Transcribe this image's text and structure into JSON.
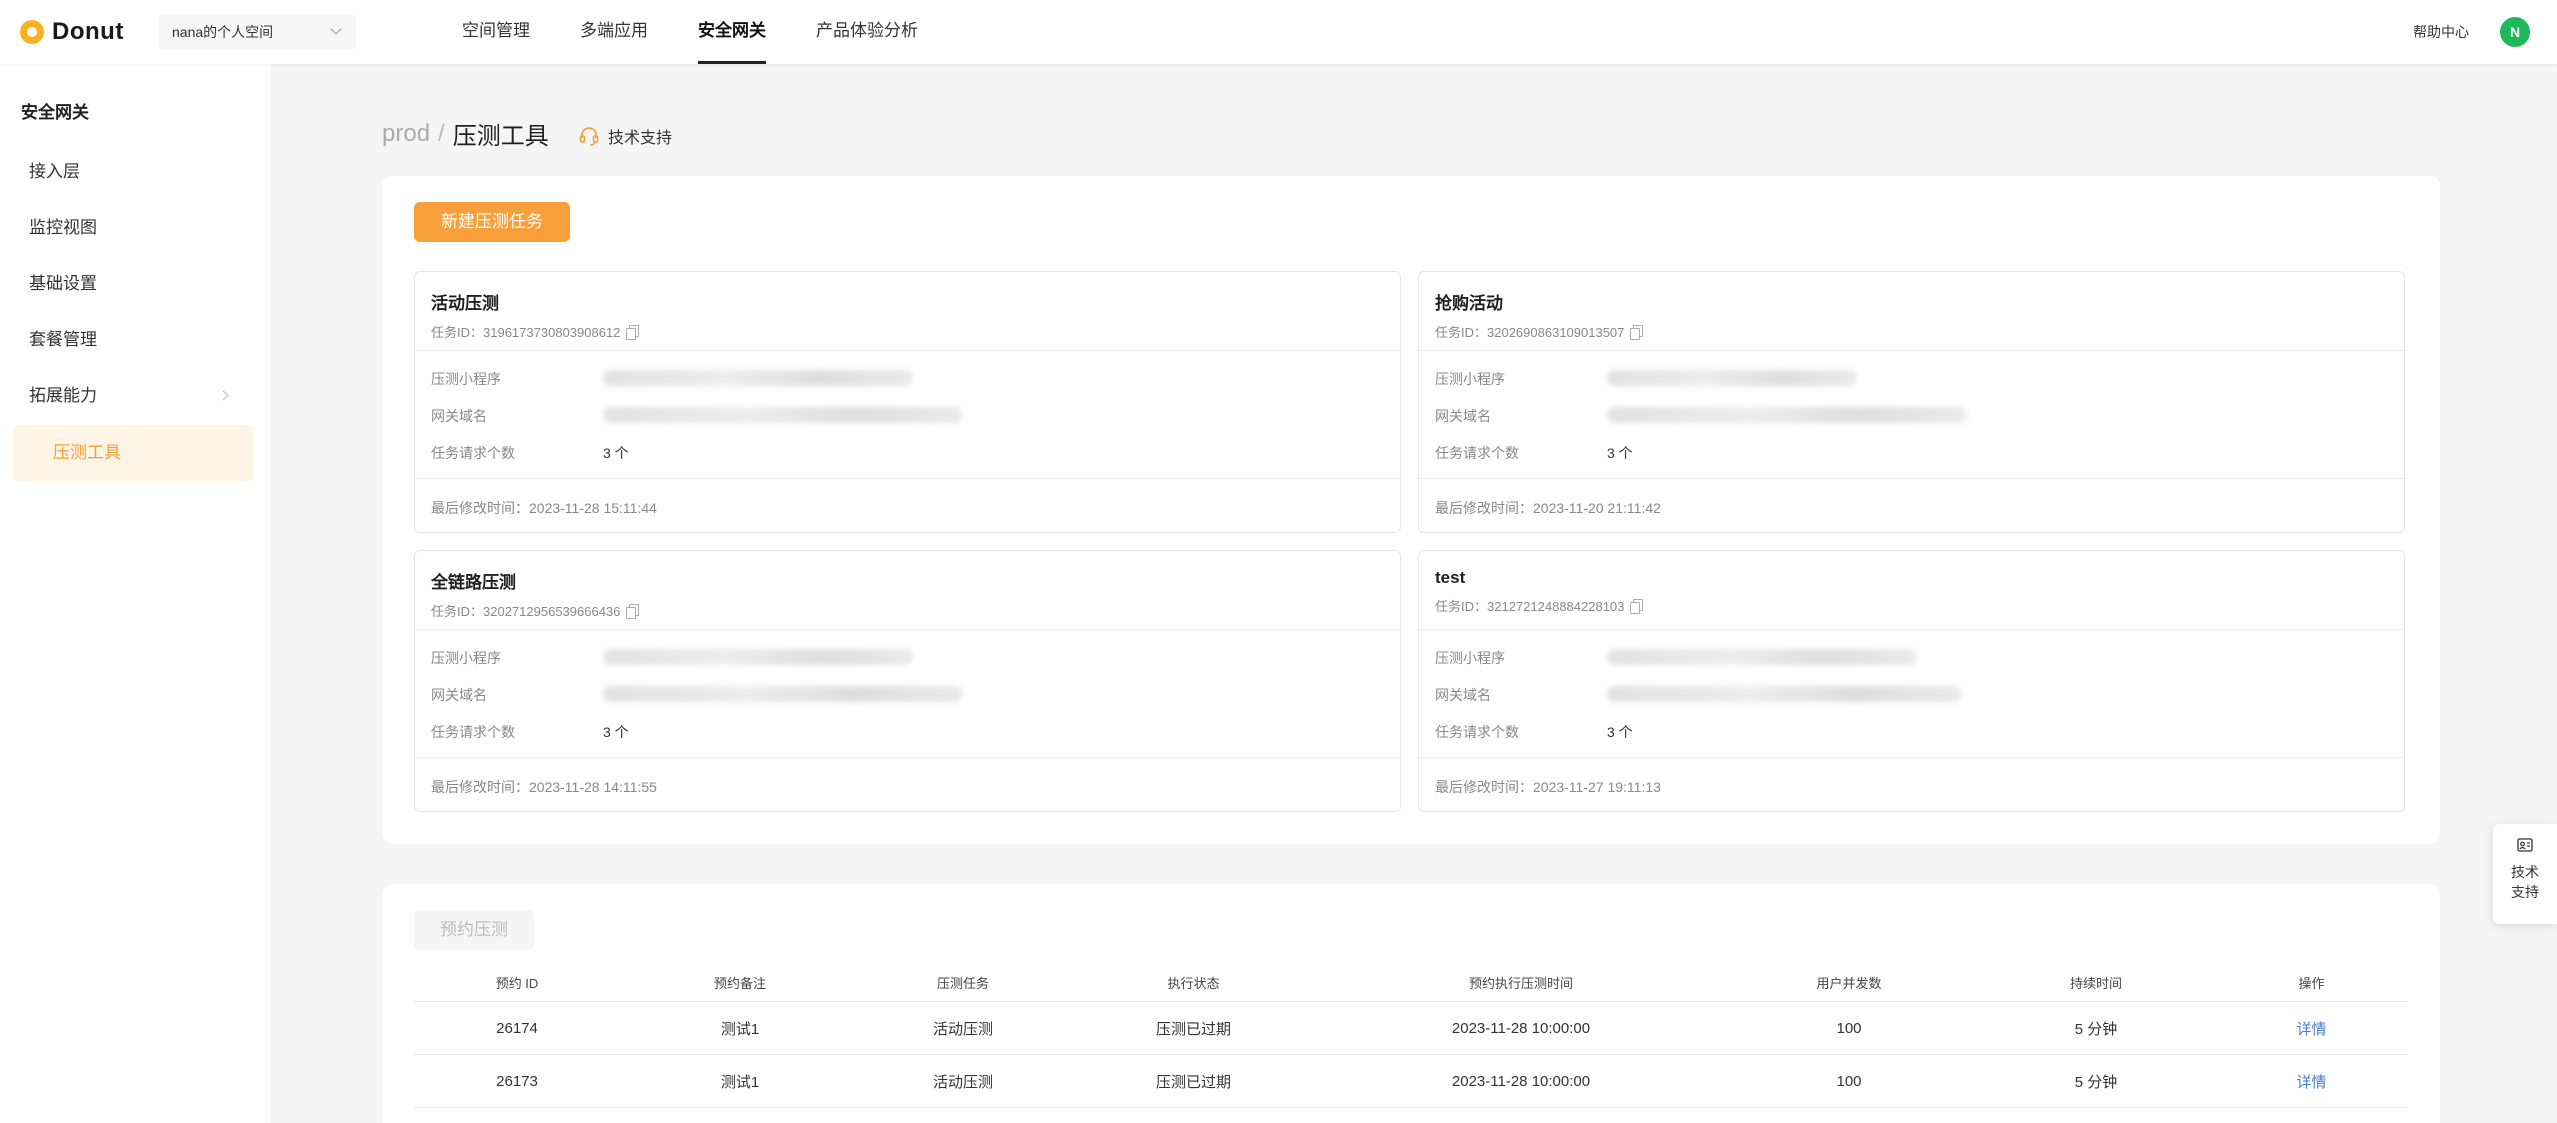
{
  "app": {
    "name": "Donut"
  },
  "workspace": {
    "selected": "nana的个人空间"
  },
  "topnav": {
    "items": [
      {
        "label": "空间管理",
        "active": false
      },
      {
        "label": "多端应用",
        "active": false
      },
      {
        "label": "安全网关",
        "active": true
      },
      {
        "label": "产品体验分析",
        "active": false
      }
    ]
  },
  "header": {
    "help": "帮助中心",
    "avatar_initial": "N"
  },
  "sidebar": {
    "title": "安全网关",
    "items": [
      {
        "label": "接入层"
      },
      {
        "label": "监控视图"
      },
      {
        "label": "基础设置"
      },
      {
        "label": "套餐管理"
      },
      {
        "label": "拓展能力"
      },
      {
        "label": "压测工具"
      }
    ]
  },
  "breadcrumb": {
    "env": "prod",
    "separator": "/",
    "title": "压测工具"
  },
  "support": {
    "label": "技术支持"
  },
  "tasks": {
    "new_button": "新建压测任务",
    "labels": {
      "program": "压测小程序",
      "domain": "网关域名",
      "requests": "任务请求个数",
      "id_prefix": "任务ID：",
      "modified_prefix": "最后修改时间："
    },
    "cards": [
      {
        "title": "活动压测",
        "id": "3196173730803908612",
        "requests": "3 个",
        "modified": "2023-11-28 15:11:44"
      },
      {
        "title": "抢购活动",
        "id": "3202690863109013507",
        "requests": "3 个",
        "modified": "2023-11-20 21:11:42"
      },
      {
        "title": "全链路压测",
        "id": "3202712956539666436",
        "requests": "3 个",
        "modified": "2023-11-28 14:11:55"
      },
      {
        "title": "test",
        "id": "3212721248884228103",
        "requests": "3 个",
        "modified": "2023-11-27 19:11:13"
      }
    ]
  },
  "schedule": {
    "button": "预约压测",
    "columns": [
      "预约 ID",
      "预约备注",
      "压测任务",
      "执行状态",
      "预约执行压测时间",
      "用户并发数",
      "持续时间",
      "操作"
    ],
    "rows": [
      {
        "id": "26174",
        "note": "测试1",
        "task": "活动压测",
        "status": "压测已过期",
        "time": "2023-11-28 10:00:00",
        "users": "100",
        "duration": "5 分钟",
        "action": "详情"
      },
      {
        "id": "26173",
        "note": "测试1",
        "task": "活动压测",
        "status": "压测已过期",
        "time": "2023-11-28 10:00:00",
        "users": "100",
        "duration": "5 分钟",
        "action": "详情"
      }
    ]
  },
  "float_support": {
    "line1": "技术",
    "line2": "支持"
  },
  "colors": {
    "accent": "#f7a03a",
    "link": "#4a7cc7",
    "avatar": "#1fb85b"
  }
}
